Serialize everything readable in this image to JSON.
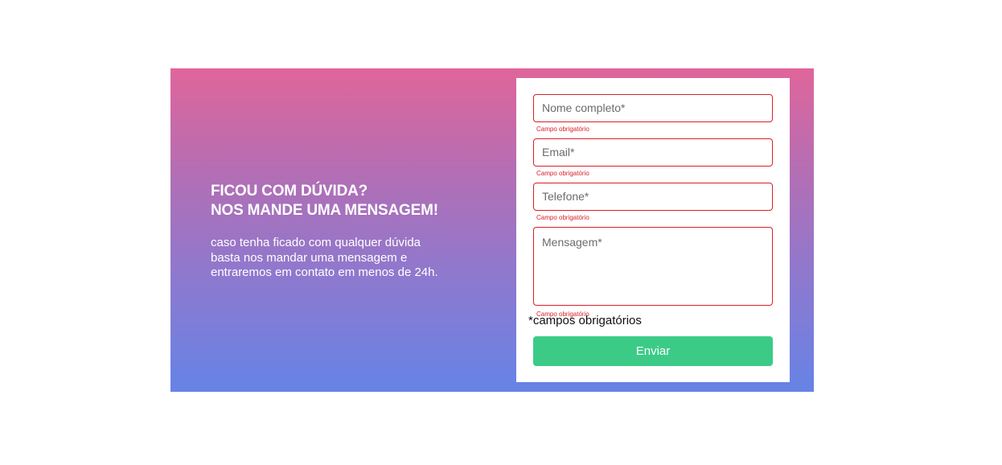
{
  "contact": {
    "heading_line1": "FICOU COM DÚVIDA?",
    "heading_line2": "NOS MANDE UMA MENSAGEM!",
    "description": "caso tenha ficado com qualquer dúvida basta nos mandar uma mensagem e entraremos em contato em menos de 24h."
  },
  "form": {
    "fields": [
      {
        "placeholder": "Nome completo*",
        "value": "",
        "error": "Campo obrigatório"
      },
      {
        "placeholder": "Email*",
        "value": "",
        "error": "Campo obrigatório"
      },
      {
        "placeholder": "Telefone*",
        "value": "",
        "error": "Campo obrigatório"
      },
      {
        "placeholder": "Mensagem*",
        "value": "",
        "error": "Campo obrigatório"
      }
    ],
    "required_note": "*campos obrigatórios",
    "submit_label": "Enviar"
  },
  "colors": {
    "gradient_top": "#e0659a",
    "gradient_bottom": "#6683e6",
    "error": "#d9202a",
    "submit": "#3bcb87"
  }
}
